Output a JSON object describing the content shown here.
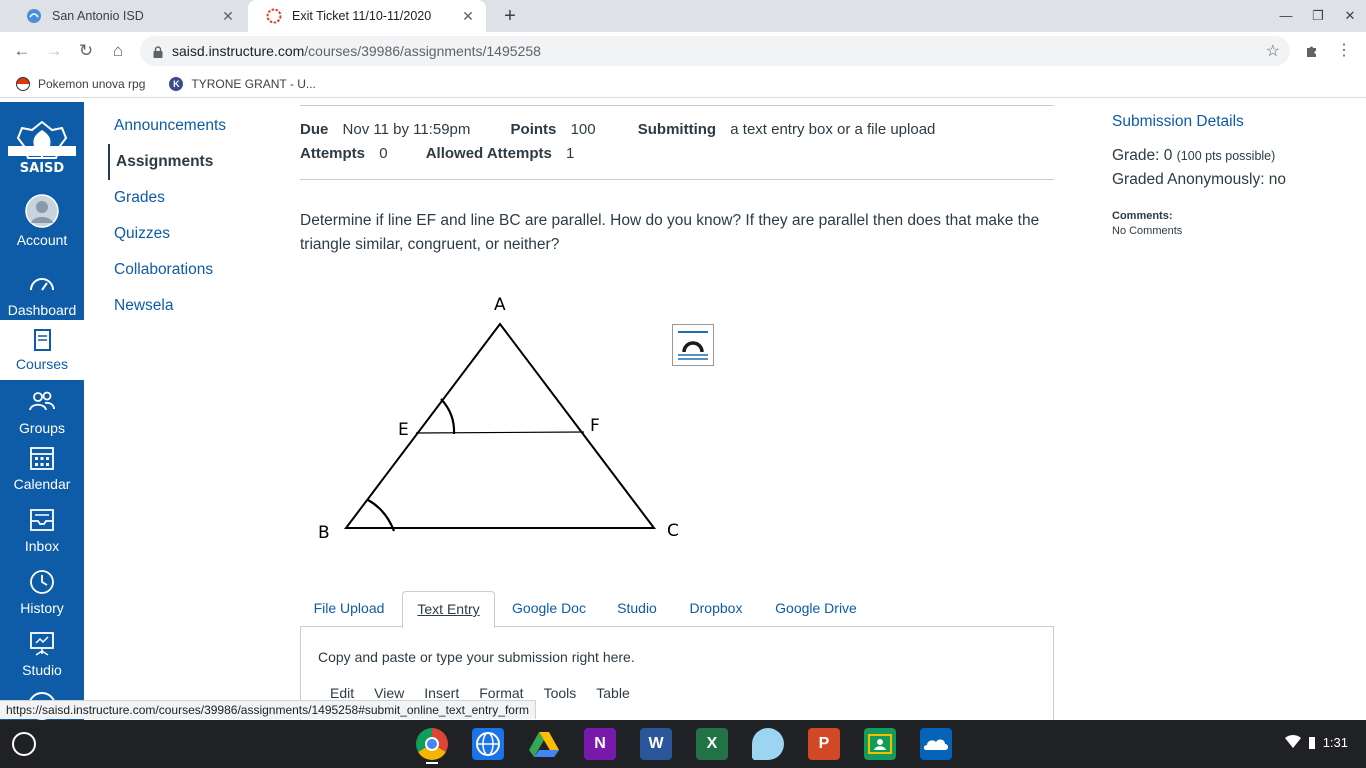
{
  "browser": {
    "tabs": [
      {
        "title": "San Antonio ISD",
        "active": false
      },
      {
        "title": "Exit Ticket 11/10-11/2020",
        "active": true
      }
    ],
    "url_host": "saisd.instructure.com",
    "url_path": "/courses/39986/assignments/1495258",
    "bookmarks": [
      "Pokemon unova rpg",
      "TYRONE GRANT - U..."
    ],
    "status_url": "https://saisd.instructure.com/courses/39986/assignments/1495258#submit_online_text_entry_form"
  },
  "logo_text": "SAISD",
  "global_nav": [
    {
      "label": "Account",
      "icon": "account-avatar-icon"
    },
    {
      "label": "Dashboard",
      "icon": "dashboard-gauge-icon"
    },
    {
      "label": "Courses",
      "icon": "book-icon",
      "active": true
    },
    {
      "label": "Groups",
      "icon": "groups-icon"
    },
    {
      "label": "Calendar",
      "icon": "calendar-icon"
    },
    {
      "label": "Inbox",
      "icon": "inbox-icon"
    },
    {
      "label": "History",
      "icon": "clock-icon"
    },
    {
      "label": "Studio",
      "icon": "studio-icon"
    }
  ],
  "course_nav": [
    {
      "label": "Announcements"
    },
    {
      "label": "Assignments",
      "active": true
    },
    {
      "label": "Grades"
    },
    {
      "label": "Quizzes"
    },
    {
      "label": "Collaborations"
    },
    {
      "label": "Newsela"
    }
  ],
  "assignment": {
    "due_label": "Due",
    "due_value": "Nov 11 by 11:59pm",
    "points_label": "Points",
    "points_value": "100",
    "submitting_label": "Submitting",
    "submitting_value": "a text entry box or a file upload",
    "attempts_label": "Attempts",
    "attempts_value": "0",
    "allowed_label": "Allowed Attempts",
    "allowed_value": "1",
    "question": "Determine if line EF and line BC are parallel. How do you know? If they are parallel then does that make the triangle similar, congruent, or neither?",
    "diagram_labels": {
      "A": "A",
      "E": "E",
      "F": "F",
      "B": "B",
      "C": "C"
    }
  },
  "submission_tabs": [
    "File Upload",
    "Text Entry",
    "Google Doc",
    "Studio",
    "Dropbox",
    "Google Drive"
  ],
  "active_submission_tab": "Text Entry",
  "panel_hint": "Copy and paste or type your submission right here.",
  "editor_menu": [
    "Edit",
    "View",
    "Insert",
    "Format",
    "Tools",
    "Table"
  ],
  "details": {
    "title": "Submission Details",
    "grade_text": "Grade: 0",
    "grade_note": "(100 pts possible)",
    "graded_anonymously": "Graded Anonymously: no",
    "comments_label": "Comments:",
    "comments_value": "No Comments"
  },
  "system": {
    "time": "1:31"
  },
  "colors": {
    "canvas_blue": "#0e5ba7",
    "text": "#2d3b45",
    "shelf": "#202124"
  }
}
